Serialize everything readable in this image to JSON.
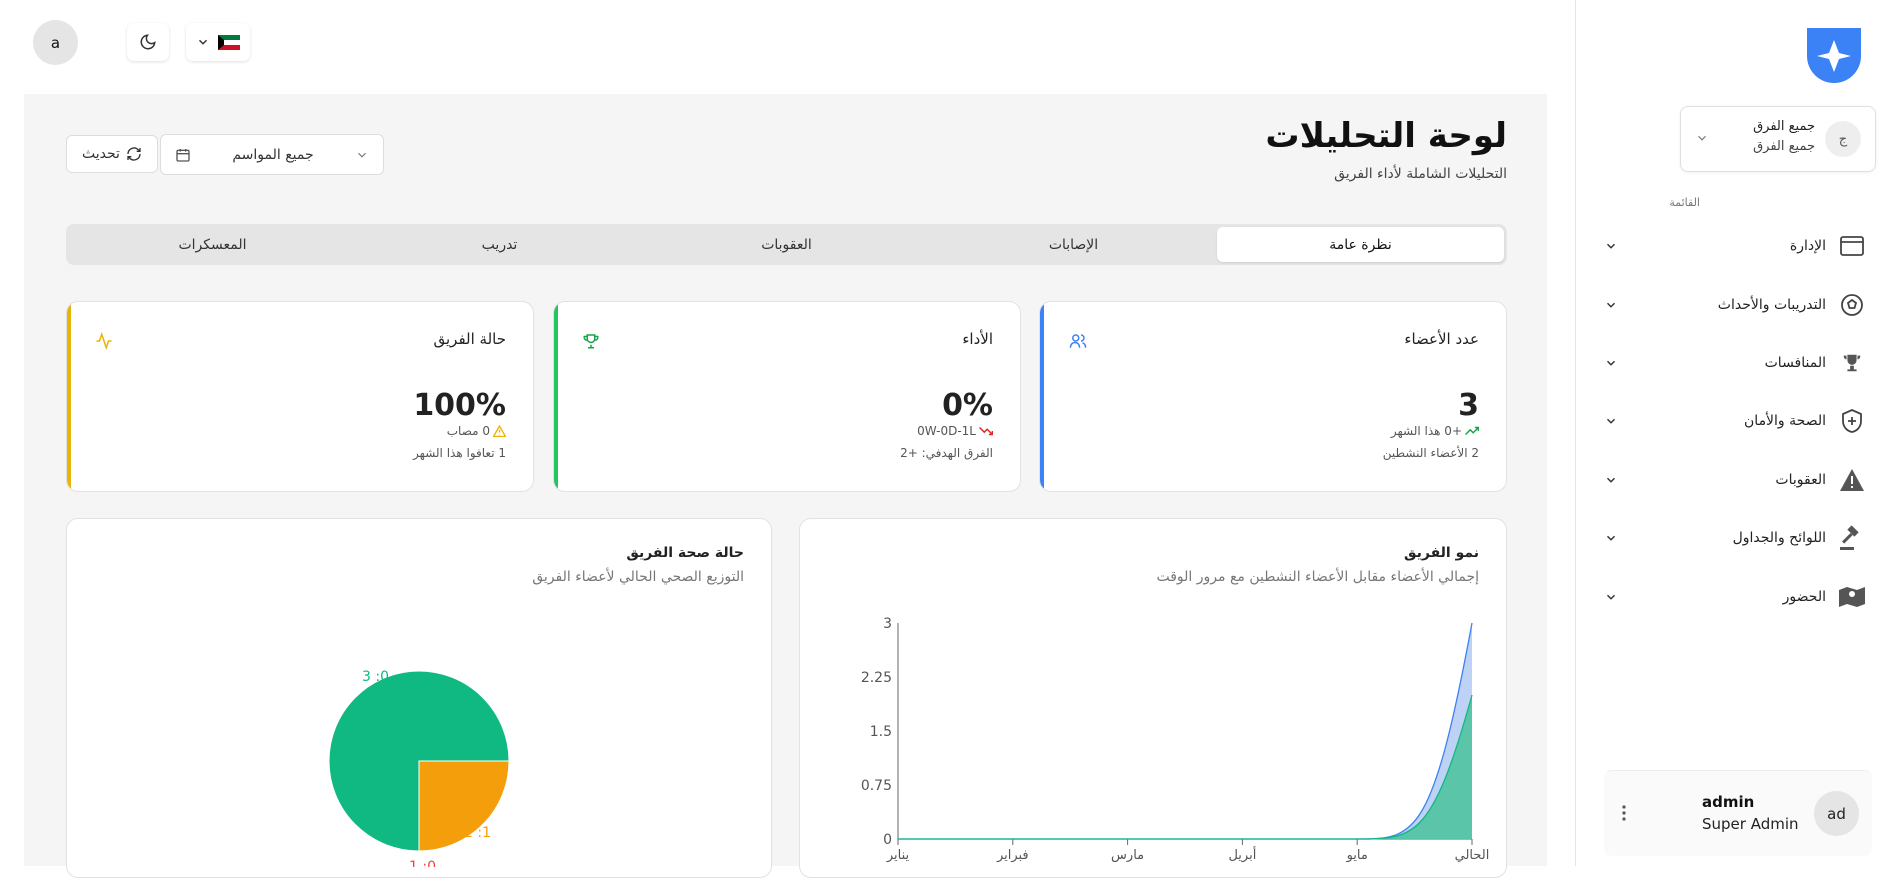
{
  "topbar": {
    "avatar_initial": "a",
    "flag": "kuwait-flag"
  },
  "header": {
    "title": "لوحة التحليلات",
    "subtitle": "التحليلات الشاملة لأداء الفريق",
    "refresh_label": "تحديث",
    "season_select": "جميع المواسم"
  },
  "tabs": [
    {
      "label": "نظرة عامة",
      "active": true
    },
    {
      "label": "الإصابات",
      "active": false
    },
    {
      "label": "العقوبات",
      "active": false
    },
    {
      "label": "تدريب",
      "active": false
    },
    {
      "label": "المعسكرات",
      "active": false
    }
  ],
  "stats": {
    "members": {
      "title": "عدد الأعضاء",
      "value": "3",
      "change": "+0 هذا الشهر",
      "note": "2 الأعضاء النشطين",
      "color": "#3b82f6"
    },
    "performance": {
      "title": "الأداء",
      "value": "0%",
      "record": "0W-0D-1L",
      "note": "الفرق الهدفي: +2",
      "color": "#22c55e"
    },
    "status": {
      "title": "حالة الفريق",
      "value": "100%",
      "injured": "0 مصاب",
      "note": "1 تعافوا هذا الشهر",
      "color": "#eab308"
    }
  },
  "growth_chart": {
    "title": "نمو الفريق",
    "subtitle": "إجمالي الأعضاء مقابل الأعضاء النشطين مع مرور الوقت"
  },
  "health_chart": {
    "title": "حالة صحة الفريق",
    "subtitle": "التوزيع الصحي الحالي لأعضاء الفريق"
  },
  "chart_data": [
    {
      "type": "area",
      "categories": [
        "يناير",
        "فبراير",
        "مارس",
        "أبريل",
        "مايو",
        "الحالي"
      ],
      "yticks": [
        "0",
        "0.75",
        "1.5",
        "2.25",
        "3"
      ],
      "ylim": [
        0,
        3
      ],
      "series": [
        {
          "values": [
            0,
            0,
            0,
            0,
            0,
            3
          ],
          "color": "#93b4f0"
        },
        {
          "values": [
            0,
            0,
            0,
            0,
            0,
            2
          ],
          "color": "#4fc3a1"
        }
      ]
    },
    {
      "type": "pie",
      "slices": [
        {
          "label": "0: 3",
          "value": 3,
          "color": "#10b981"
        },
        {
          "label": "1: 2",
          "value": 1,
          "color": "#f59e0b"
        },
        {
          "label": "0: 1",
          "value": 0,
          "color": "#ef4444"
        }
      ]
    }
  ],
  "sidebar": {
    "team_select": {
      "title": "جميع الفرق",
      "subtitle": "جميع الفرق",
      "badge": "ج"
    },
    "menu_label": "القائمة",
    "items": [
      {
        "label": "الإدارة",
        "icon": "admin-icon"
      },
      {
        "label": "التدريبات والأحداث",
        "icon": "ball-icon"
      },
      {
        "label": "المنافسات",
        "icon": "trophy-icon"
      },
      {
        "label": "الصحة والأمان",
        "icon": "shield-icon"
      },
      {
        "label": "العقوبات",
        "icon": "warning-icon"
      },
      {
        "label": "اللوائح والجداول",
        "icon": "gavel-icon"
      },
      {
        "label": "الحضور",
        "icon": "map-icon"
      }
    ],
    "user": {
      "name": "admin",
      "role": "Super Admin",
      "initials": "ad"
    }
  }
}
